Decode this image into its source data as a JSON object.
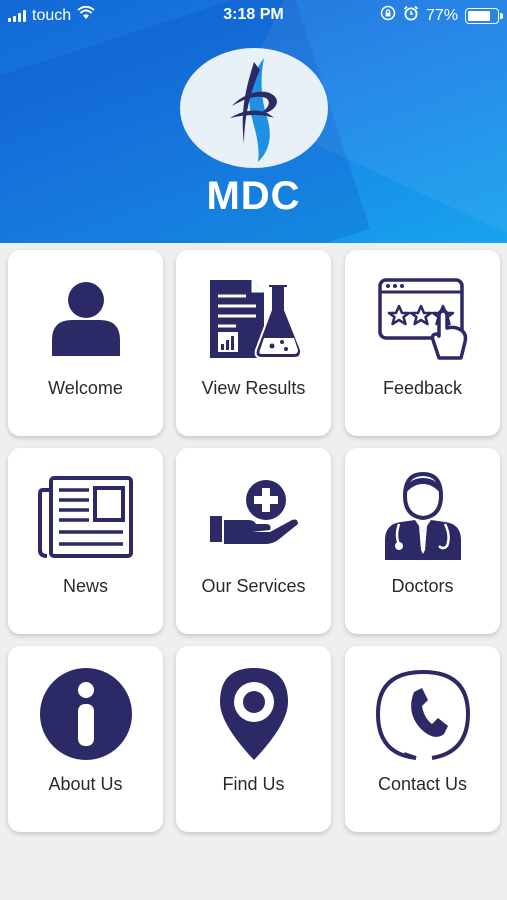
{
  "status_bar": {
    "carrier": "touch",
    "time": "3:18 PM",
    "battery_percent": "77%",
    "battery_level": 0.77,
    "icons": [
      "signal-icon",
      "wifi-icon",
      "rotation-lock-icon",
      "alarm-icon",
      "battery-icon"
    ]
  },
  "header": {
    "title": "MDC",
    "logo": "mdc-logo-icon"
  },
  "colors": {
    "accent": "#1b7fe6",
    "icon": "#2b2a66",
    "tile": "#ffffff",
    "background": "#efeff0"
  },
  "menu": [
    {
      "label": "Welcome",
      "icon": "user-icon"
    },
    {
      "label": "View Results",
      "icon": "lab-results-icon"
    },
    {
      "label": "Feedback",
      "icon": "rating-feedback-icon"
    },
    {
      "label": "News",
      "icon": "newspaper-icon"
    },
    {
      "label": "Our Services",
      "icon": "care-services-icon"
    },
    {
      "label": "Doctors",
      "icon": "doctor-icon"
    },
    {
      "label": "About Us",
      "icon": "info-icon"
    },
    {
      "label": "Find Us",
      "icon": "location-pin-icon"
    },
    {
      "label": "Contact Us",
      "icon": "phone-icon"
    }
  ]
}
